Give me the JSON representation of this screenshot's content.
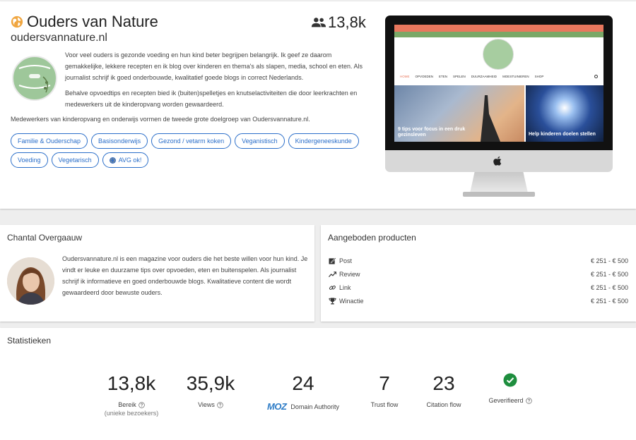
{
  "site": {
    "title": "Ouders van Nature",
    "domain": "oudersvannature.nl",
    "reach": "13,8k",
    "description": [
      "Voor veel ouders is gezonde voeding en hun kind beter begrijpen belangrijk. Ik geef ze daarom gemakkelijke, lekkere recepten en ik blog over kinderen en thema's als slapen, media, school en eten. Als journalist schrijf ik goed onderbouwde, kwalitatief goede blogs in correct Nederlands.",
      "Behalve opvoedtips en recepten bied ik (buiten)spelletjes en knutselactiviteiten die door leerkrachten en medewerkers uit de kinderopvang worden gewaardeerd.",
      "Medewerkers van kinderopvang en onderwijs vormen de tweede grote doelgroep van Oudersvannature.nl."
    ],
    "tags": [
      "Familie & Ouderschap",
      "Basisonderwijs",
      "Gezond / vetarm koken",
      "Veganistisch",
      "Kindergeneeskunde",
      "Voeding",
      "Vegetarisch"
    ],
    "avg_tag": "AVG ok!",
    "accent_color": "#2a6ec9"
  },
  "preview": {
    "nav": [
      "HOME",
      "OPVOEDEN",
      "ETEN",
      "SPELEN",
      "DUURZAAMHEID",
      "MOESTUINIEREN",
      "SHOP"
    ],
    "article1": "9 tips voor focus in een druk gezinsleven",
    "article2": "Help kinderen doelen stellen"
  },
  "author": {
    "section_title": "Chantal Overgaauw",
    "text": "Oudersvannature.nl is een magazine voor ouders die het beste willen voor hun kind. Je vindt er leuke en duurzame tips over opvoeden, eten en buitenspelen. Als journalist schrijf ik informatieve en goed onderbouwde blogs. Kwalitatieve content die wordt gewaardeerd door bewuste ouders."
  },
  "products": {
    "section_title": "Aangeboden producten",
    "items": [
      {
        "label": "Post",
        "price": "€ 251 - € 500",
        "icon": "post-icon"
      },
      {
        "label": "Review",
        "price": "€ 251 - € 500",
        "icon": "trend-icon"
      },
      {
        "label": "Link",
        "price": "€ 251 - € 500",
        "icon": "link-icon"
      },
      {
        "label": "Winactie",
        "price": "€ 251 - € 500",
        "icon": "trophy-icon"
      }
    ]
  },
  "stats": {
    "section_title": "Statistieken",
    "reach_value": "13,8k",
    "reach_label": "Bereik",
    "reach_sub": "(unieke bezoekers)",
    "views_value": "35,9k",
    "views_label": "Views",
    "da_value": "24",
    "da_logo": "MOZ",
    "da_label": "Domain Authority",
    "tf_value": "7",
    "tf_label": "Trust flow",
    "cf_value": "23",
    "cf_label": "Citation flow",
    "verified_label": "Geverifieerd",
    "verified_color": "#1e8e3e"
  }
}
